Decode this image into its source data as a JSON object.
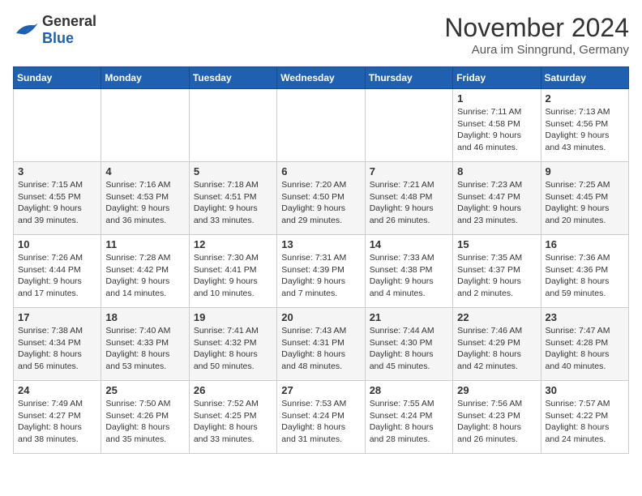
{
  "header": {
    "logo_general": "General",
    "logo_blue": "Blue",
    "month": "November 2024",
    "location": "Aura im Sinngrund, Germany"
  },
  "weekdays": [
    "Sunday",
    "Monday",
    "Tuesday",
    "Wednesday",
    "Thursday",
    "Friday",
    "Saturday"
  ],
  "weeks": [
    [
      {
        "day": "",
        "info": ""
      },
      {
        "day": "",
        "info": ""
      },
      {
        "day": "",
        "info": ""
      },
      {
        "day": "",
        "info": ""
      },
      {
        "day": "",
        "info": ""
      },
      {
        "day": "1",
        "info": "Sunrise: 7:11 AM\nSunset: 4:58 PM\nDaylight: 9 hours\nand 46 minutes."
      },
      {
        "day": "2",
        "info": "Sunrise: 7:13 AM\nSunset: 4:56 PM\nDaylight: 9 hours\nand 43 minutes."
      }
    ],
    [
      {
        "day": "3",
        "info": "Sunrise: 7:15 AM\nSunset: 4:55 PM\nDaylight: 9 hours\nand 39 minutes."
      },
      {
        "day": "4",
        "info": "Sunrise: 7:16 AM\nSunset: 4:53 PM\nDaylight: 9 hours\nand 36 minutes."
      },
      {
        "day": "5",
        "info": "Sunrise: 7:18 AM\nSunset: 4:51 PM\nDaylight: 9 hours\nand 33 minutes."
      },
      {
        "day": "6",
        "info": "Sunrise: 7:20 AM\nSunset: 4:50 PM\nDaylight: 9 hours\nand 29 minutes."
      },
      {
        "day": "7",
        "info": "Sunrise: 7:21 AM\nSunset: 4:48 PM\nDaylight: 9 hours\nand 26 minutes."
      },
      {
        "day": "8",
        "info": "Sunrise: 7:23 AM\nSunset: 4:47 PM\nDaylight: 9 hours\nand 23 minutes."
      },
      {
        "day": "9",
        "info": "Sunrise: 7:25 AM\nSunset: 4:45 PM\nDaylight: 9 hours\nand 20 minutes."
      }
    ],
    [
      {
        "day": "10",
        "info": "Sunrise: 7:26 AM\nSunset: 4:44 PM\nDaylight: 9 hours\nand 17 minutes."
      },
      {
        "day": "11",
        "info": "Sunrise: 7:28 AM\nSunset: 4:42 PM\nDaylight: 9 hours\nand 14 minutes."
      },
      {
        "day": "12",
        "info": "Sunrise: 7:30 AM\nSunset: 4:41 PM\nDaylight: 9 hours\nand 10 minutes."
      },
      {
        "day": "13",
        "info": "Sunrise: 7:31 AM\nSunset: 4:39 PM\nDaylight: 9 hours\nand 7 minutes."
      },
      {
        "day": "14",
        "info": "Sunrise: 7:33 AM\nSunset: 4:38 PM\nDaylight: 9 hours\nand 4 minutes."
      },
      {
        "day": "15",
        "info": "Sunrise: 7:35 AM\nSunset: 4:37 PM\nDaylight: 9 hours\nand 2 minutes."
      },
      {
        "day": "16",
        "info": "Sunrise: 7:36 AM\nSunset: 4:36 PM\nDaylight: 8 hours\nand 59 minutes."
      }
    ],
    [
      {
        "day": "17",
        "info": "Sunrise: 7:38 AM\nSunset: 4:34 PM\nDaylight: 8 hours\nand 56 minutes."
      },
      {
        "day": "18",
        "info": "Sunrise: 7:40 AM\nSunset: 4:33 PM\nDaylight: 8 hours\nand 53 minutes."
      },
      {
        "day": "19",
        "info": "Sunrise: 7:41 AM\nSunset: 4:32 PM\nDaylight: 8 hours\nand 50 minutes."
      },
      {
        "day": "20",
        "info": "Sunrise: 7:43 AM\nSunset: 4:31 PM\nDaylight: 8 hours\nand 48 minutes."
      },
      {
        "day": "21",
        "info": "Sunrise: 7:44 AM\nSunset: 4:30 PM\nDaylight: 8 hours\nand 45 minutes."
      },
      {
        "day": "22",
        "info": "Sunrise: 7:46 AM\nSunset: 4:29 PM\nDaylight: 8 hours\nand 42 minutes."
      },
      {
        "day": "23",
        "info": "Sunrise: 7:47 AM\nSunset: 4:28 PM\nDaylight: 8 hours\nand 40 minutes."
      }
    ],
    [
      {
        "day": "24",
        "info": "Sunrise: 7:49 AM\nSunset: 4:27 PM\nDaylight: 8 hours\nand 38 minutes."
      },
      {
        "day": "25",
        "info": "Sunrise: 7:50 AM\nSunset: 4:26 PM\nDaylight: 8 hours\nand 35 minutes."
      },
      {
        "day": "26",
        "info": "Sunrise: 7:52 AM\nSunset: 4:25 PM\nDaylight: 8 hours\nand 33 minutes."
      },
      {
        "day": "27",
        "info": "Sunrise: 7:53 AM\nSunset: 4:24 PM\nDaylight: 8 hours\nand 31 minutes."
      },
      {
        "day": "28",
        "info": "Sunrise: 7:55 AM\nSunset: 4:24 PM\nDaylight: 8 hours\nand 28 minutes."
      },
      {
        "day": "29",
        "info": "Sunrise: 7:56 AM\nSunset: 4:23 PM\nDaylight: 8 hours\nand 26 minutes."
      },
      {
        "day": "30",
        "info": "Sunrise: 7:57 AM\nSunset: 4:22 PM\nDaylight: 8 hours\nand 24 minutes."
      }
    ]
  ]
}
